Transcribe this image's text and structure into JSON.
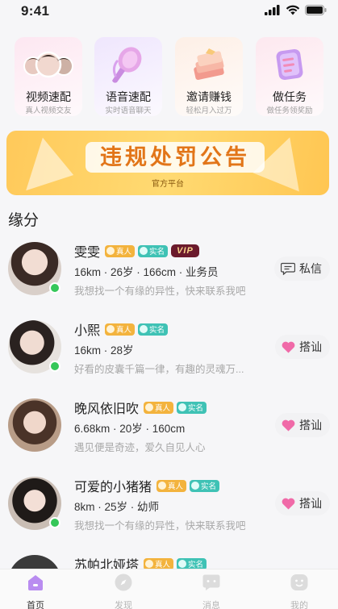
{
  "status": {
    "time": "9:41"
  },
  "quick_actions": [
    {
      "title": "视频速配",
      "subtitle": "真人视频交友",
      "icon": "avatar-group-icon",
      "bg": "#fde7f1"
    },
    {
      "title": "语音速配",
      "subtitle": "实时语音聊天",
      "icon": "microphone-icon",
      "bg": "#efe6fd"
    },
    {
      "title": "邀请赚钱",
      "subtitle": "轻松月入过万",
      "icon": "money-stack-icon",
      "bg": "#fdefe6"
    },
    {
      "title": "做任务",
      "subtitle": "做任务领奖励",
      "icon": "task-list-icon",
      "bg": "#fde8ef"
    }
  ],
  "banner": {
    "headline": "违规处罚公告",
    "caption": "官方平台"
  },
  "section": {
    "title": "缘分"
  },
  "users": [
    {
      "name": "雯雯",
      "badges": [
        "真人",
        "实名"
      ],
      "vip": "VIP",
      "meta": "16km · 26岁 · 166cm · 业务员",
      "desc": "我想找一个有缘的异性，快来联系我吧",
      "action": "私信",
      "action_icon": "chat-bubble-icon",
      "online": true,
      "avatar_tone": "#d9cfc9"
    },
    {
      "name": "小熙",
      "badges": [
        "真人",
        "实名"
      ],
      "vip": "",
      "meta": "16km · 28岁",
      "desc": "好看的皮囊千篇一律，有趣的灵魂万...",
      "action": "搭讪",
      "action_icon": "heart-icon",
      "online": true,
      "avatar_tone": "#e6e2de"
    },
    {
      "name": "晚风依旧吹",
      "badges": [
        "真人",
        "实名"
      ],
      "vip": "",
      "meta": "6.68km · 20岁 · 160cm",
      "desc": "遇见便是奇迹，爱久自见人心",
      "action": "搭讪",
      "action_icon": "heart-icon",
      "online": false,
      "avatar_tone": "#b89c87"
    },
    {
      "name": "可爱的小猪猪",
      "badges": [
        "真人",
        "实名"
      ],
      "vip": "",
      "meta": "8km · 25岁 · 幼师",
      "desc": "我想找一个有缘的异性，快来联系我吧",
      "action": "搭讪",
      "action_icon": "heart-icon",
      "online": true,
      "avatar_tone": "#c9bdb4"
    },
    {
      "name": "苏帕北娅塔",
      "badges": [
        "真人",
        "实名"
      ],
      "vip": "",
      "meta": "",
      "desc": "",
      "action": "",
      "action_icon": "",
      "online": false,
      "avatar_tone": "#3b3b3b"
    }
  ],
  "tabs": [
    {
      "label": "首页",
      "icon": "home-icon",
      "active": true
    },
    {
      "label": "发现",
      "icon": "compass-icon",
      "active": false
    },
    {
      "label": "消息",
      "icon": "message-icon",
      "active": false
    },
    {
      "label": "我的",
      "icon": "profile-icon",
      "active": false
    }
  ],
  "colors": {
    "accent": "#b98cf0",
    "real_badge": "#f3b33d",
    "verified_badge": "#3fc2b5",
    "heart": "#f06aa8",
    "online": "#35c759"
  }
}
